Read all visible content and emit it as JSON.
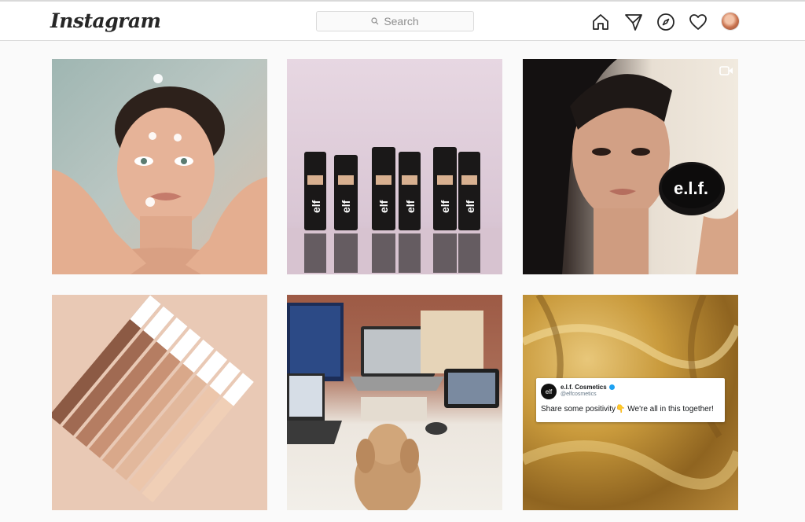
{
  "header": {
    "logo": "Instagram",
    "search_placeholder": "Search"
  },
  "nav": [
    "home-icon",
    "direct-icon",
    "explore-icon",
    "activity-icon",
    "profile-avatar"
  ],
  "posts": [
    {
      "id": "post-1",
      "type": "image"
    },
    {
      "id": "post-2",
      "type": "image",
      "brand_text": "elf"
    },
    {
      "id": "post-3",
      "type": "video",
      "brand_text": "e.l.f."
    },
    {
      "id": "post-4",
      "type": "image"
    },
    {
      "id": "post-5",
      "type": "image"
    },
    {
      "id": "post-6",
      "type": "image"
    }
  ],
  "tweet": {
    "avatar_text": "elf",
    "name": "e.l.f. Cosmetics",
    "handle": "@elfcosmetics",
    "text": "Share some positivity👇 We're all in this together!"
  },
  "colors": {
    "topbar_bg": "#ffffff",
    "page_bg": "#fafafa",
    "border": "#dbdbdb",
    "text": "#262626",
    "muted": "#8e8e8e",
    "verified": "#1da1f2"
  }
}
